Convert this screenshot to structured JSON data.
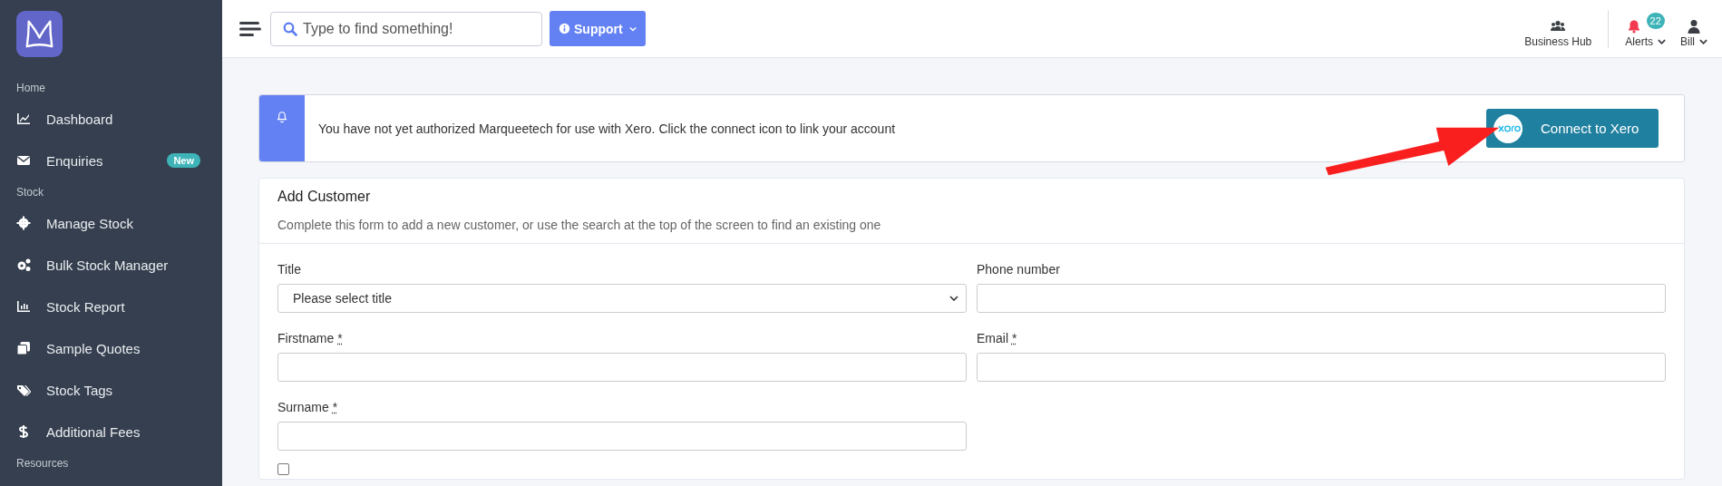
{
  "sidebar": {
    "sections": [
      {
        "heading": "Home",
        "items": [
          {
            "label": "Dashboard"
          },
          {
            "label": "Enquiries",
            "badge": "New"
          }
        ]
      },
      {
        "heading": "Stock",
        "items": [
          {
            "label": "Manage Stock"
          },
          {
            "label": "Bulk Stock Manager"
          },
          {
            "label": "Stock Report"
          },
          {
            "label": "Sample Quotes"
          },
          {
            "label": "Stock Tags"
          },
          {
            "label": "Additional Fees"
          }
        ]
      },
      {
        "heading": "Resources"
      }
    ]
  },
  "topbar": {
    "search": {
      "placeholder": "Type to find something!"
    },
    "support_button": "Support",
    "right": [
      {
        "label": "Business Hub"
      },
      {
        "label": "Alerts",
        "badge": "22"
      },
      {
        "label": "Bill"
      }
    ]
  },
  "alert": {
    "message": "You have not yet authorized Marqueetech for use with Xero. Click the connect icon to link your account",
    "button": "Connect to Xero"
  },
  "form": {
    "title": "Add Customer",
    "subtitle": "Complete this form to add a new customer, or use the search at the top of the screen to find an existing one",
    "fields": [
      {
        "label": "Title",
        "kind": "select",
        "value": "Please select title"
      },
      {
        "label": "Phone number",
        "kind": "input"
      },
      {
        "label": "Firstname",
        "kind": "input",
        "required_mark": "*"
      },
      {
        "label": "Email",
        "kind": "input",
        "required_mark": "*"
      },
      {
        "label": "Surname",
        "kind": "input",
        "required_mark": "*"
      }
    ],
    "checkbox": {
      "checked": false
    }
  }
}
